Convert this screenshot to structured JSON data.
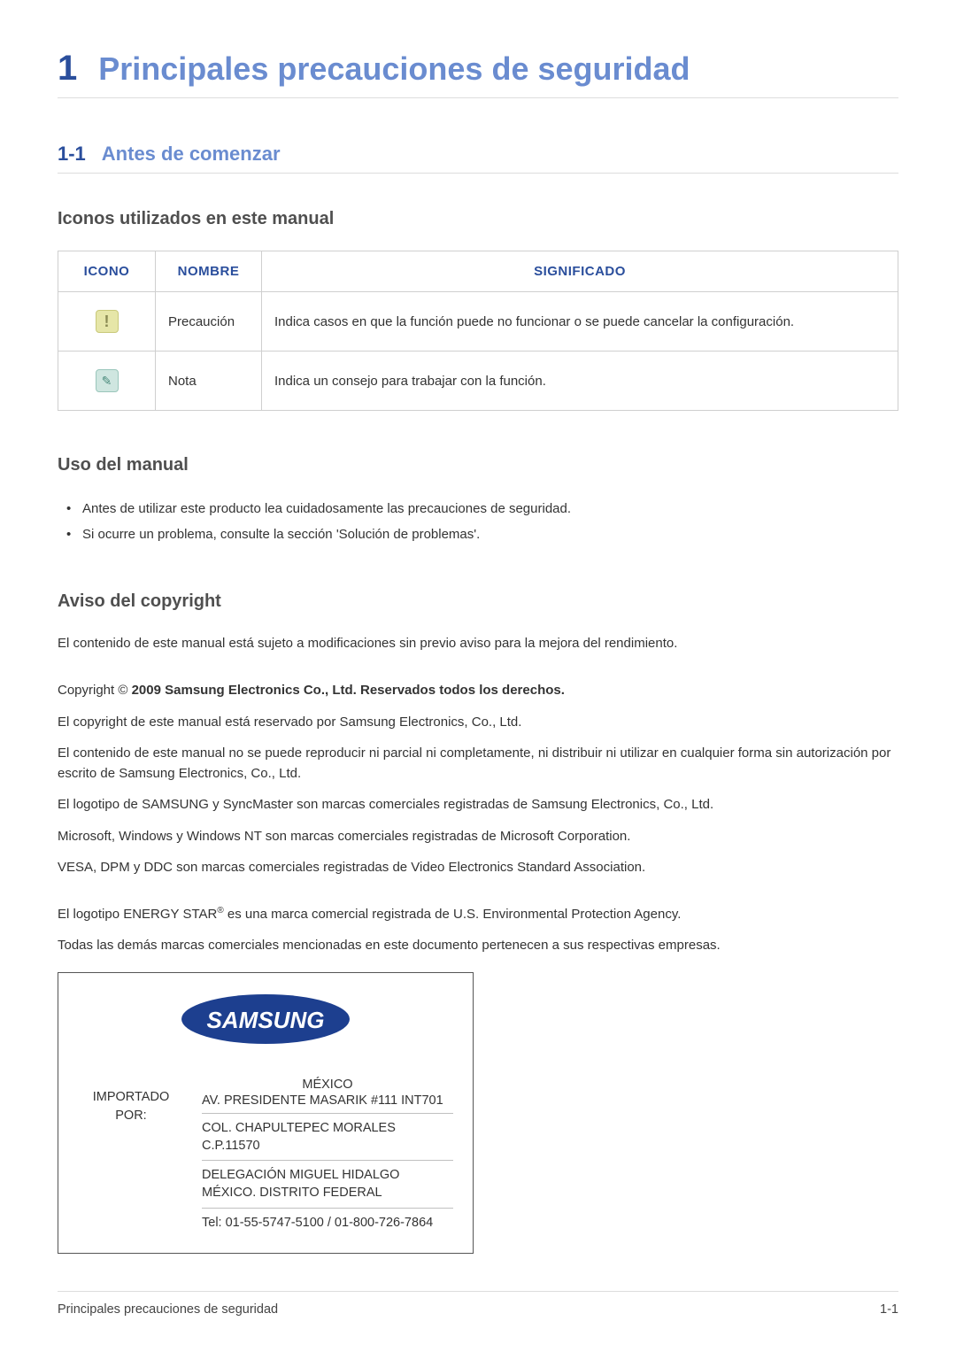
{
  "chapter": {
    "num": "1",
    "title": "Principales precauciones de seguridad"
  },
  "section": {
    "num": "1-1",
    "title": "Antes de comenzar"
  },
  "subsections": {
    "icons_title": "Iconos utilizados en este manual",
    "usage_title": "Uso del manual",
    "copyright_title": "Aviso del copyright"
  },
  "icon_table": {
    "headers": {
      "icon": "ICONO",
      "name": "NOMBRE",
      "meaning": "SIGNIFICADO"
    },
    "rows": [
      {
        "icon_glyph": "!",
        "name": "Precaución",
        "meaning": "Indica casos en que la función puede no funcionar o se puede cancelar la configuración."
      },
      {
        "icon_glyph": "✎",
        "name": "Nota",
        "meaning": "Indica un consejo para trabajar con la función."
      }
    ]
  },
  "usage_bullets": [
    "Antes de utilizar este producto lea cuidadosamente las precauciones de seguridad.",
    "Si ocurre un problema, consulte la sección 'Solución de problemas'."
  ],
  "copyright": {
    "intro": "El contenido de este manual está sujeto a modificaciones sin previo aviso para la mejora del rendimiento.",
    "line_prefix": "Copyright © ",
    "line_strong": "2009 Samsung Electronics Co., Ltd. Reservados todos los derechos.",
    "p1": "El copyright de este manual está reservado por Samsung Electronics, Co., Ltd.",
    "p2": "El contenido de este manual no se puede reproducir ni parcial ni completamente, ni distribuir ni utilizar en cualquier forma sin autorización por escrito de Samsung Electronics, Co., Ltd.",
    "p3": "El logotipo de SAMSUNG y SyncMaster son marcas comerciales registradas de Samsung Electronics, Co., Ltd.",
    "p4": "Microsoft, Windows y Windows NT son marcas comerciales registradas de Microsoft Corporation.",
    "p5": "VESA, DPM y DDC son marcas comerciales registradas de Video Electronics Standard Association.",
    "energy_pre": "El logotipo ENERGY STAR",
    "energy_sup": "®",
    "energy_post": " es una marca comercial registrada de U.S. Environmental Protection Agency.",
    "p7": "Todas las demás marcas comerciales mencionadas en este documento pertenecen a sus respectivas empresas."
  },
  "imported": {
    "label_line1": "IMPORTADO",
    "label_line2": "POR:",
    "country": "MÉXICO",
    "addr1": "AV. PRESIDENTE MASARIK #111 INT701",
    "addr2": "COL. CHAPULTEPEC MORALES C.P.11570",
    "addr3": "DELEGACIÓN MIGUEL HIDALGO MÉXICO. DISTRITO FEDERAL",
    "tel": "Tel: 01-55-5747-5100 / 01-800-726-7864"
  },
  "footer": {
    "left": "Principales precauciones de seguridad",
    "right": "1-1"
  },
  "logo_text": "SAMSUNG"
}
